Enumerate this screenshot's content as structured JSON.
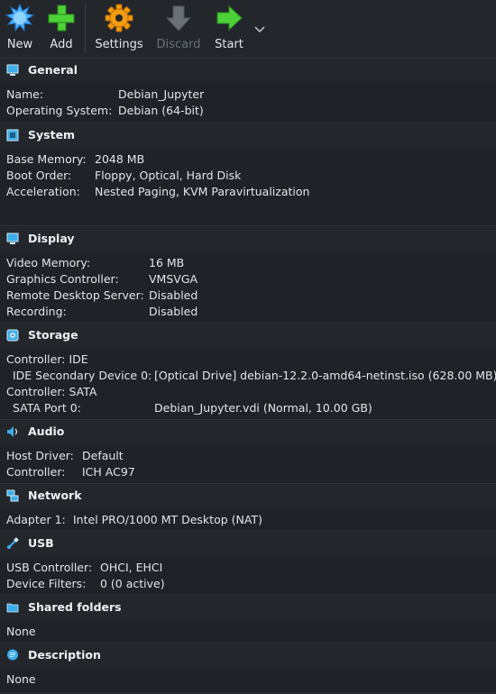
{
  "toolbar": {
    "new": "New",
    "add": "Add",
    "settings": "Settings",
    "discard": "Discard",
    "start": "Start"
  },
  "general": {
    "title": "General",
    "name_label": "Name:",
    "name_value": "Debian_Jupyter",
    "os_label": "Operating System:",
    "os_value": "Debian (64-bit)"
  },
  "system": {
    "title": "System",
    "mem_label": "Base Memory:",
    "mem_value": "2048 MB",
    "boot_label": "Boot Order:",
    "boot_value": "Floppy, Optical, Hard Disk",
    "accel_label": "Acceleration:",
    "accel_value": "Nested Paging, KVM Paravirtualization"
  },
  "display": {
    "title": "Display",
    "vmem_label": "Video Memory:",
    "vmem_value": "16 MB",
    "gfx_label": "Graphics Controller:",
    "gfx_value": "VMSVGA",
    "rds_label": "Remote Desktop Server:",
    "rds_value": "Disabled",
    "rec_label": "Recording:",
    "rec_value": "Disabled"
  },
  "storage": {
    "title": "Storage",
    "ctrl_ide": "Controller: IDE",
    "ide_dev_label": "IDE Secondary Device 0:",
    "ide_dev_value": "[Optical Drive] debian-12.2.0-amd64-netinst.iso (628.00 MB)",
    "ctrl_sata": "Controller: SATA",
    "sata_label": "SATA Port 0:",
    "sata_value": "Debian_Jupyter.vdi (Normal, 10.00 GB)"
  },
  "audio": {
    "title": "Audio",
    "host_label": "Host Driver:",
    "host_value": "Default",
    "ctrl_label": "Controller:",
    "ctrl_value": "ICH AC97"
  },
  "network": {
    "title": "Network",
    "adapter_label": "Adapter 1:",
    "adapter_value": "Intel PRO/1000 MT Desktop (NAT)"
  },
  "usb": {
    "title": "USB",
    "ctrl_label": "USB Controller:",
    "ctrl_value": "OHCI, EHCI",
    "filters_label": "Device Filters:",
    "filters_value": "0 (0 active)"
  },
  "shared": {
    "title": "Shared folders",
    "value": "None"
  },
  "description": {
    "title": "Description",
    "value": "None"
  },
  "colors": {
    "background": "#1f2226",
    "header": "#23272c",
    "text": "#e3e5e8",
    "accent_blue": "#3daee9"
  }
}
